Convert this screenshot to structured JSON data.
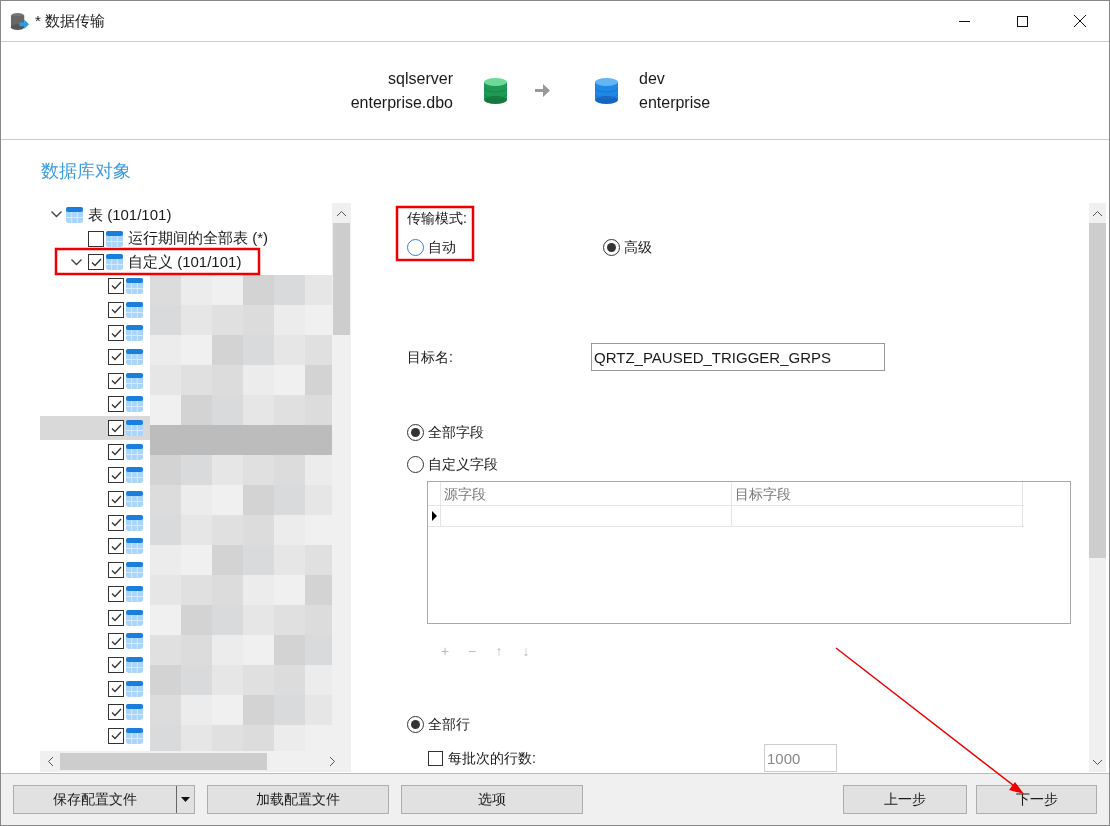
{
  "window": {
    "title": "* 数据传输"
  },
  "header": {
    "source": {
      "server": "sqlserver",
      "database": "enterprise.dbo"
    },
    "target": {
      "server": "dev",
      "database": "enterprise"
    }
  },
  "section_title": "数据库对象",
  "tree": [
    {
      "label": "表 (101/101)",
      "expanded": true,
      "children": [
        {
          "label": "运行期间的全部表 (*)",
          "checked": false
        },
        {
          "label": "自定义 (101/101)",
          "checked": true,
          "expanded": true,
          "children": [
            {
              "checked": true,
              "selected": false
            },
            {
              "checked": true,
              "selected": false
            },
            {
              "checked": true,
              "selected": false
            },
            {
              "checked": true,
              "selected": false
            },
            {
              "checked": true,
              "selected": false
            },
            {
              "checked": true,
              "selected": false
            },
            {
              "checked": true,
              "selected": true
            },
            {
              "checked": true,
              "selected": false
            },
            {
              "checked": true,
              "selected": false
            },
            {
              "checked": true,
              "selected": false
            },
            {
              "checked": true,
              "selected": false
            },
            {
              "checked": true,
              "selected": false
            },
            {
              "checked": true,
              "selected": false
            },
            {
              "checked": true,
              "selected": false
            },
            {
              "checked": true,
              "selected": false
            },
            {
              "checked": true,
              "selected": false
            },
            {
              "checked": true,
              "selected": false
            },
            {
              "checked": true,
              "selected": false
            },
            {
              "checked": true,
              "selected": false
            },
            {
              "checked": true,
              "selected": false
            }
          ]
        }
      ]
    }
  ],
  "transfer_mode": {
    "label": "传输模式:",
    "options": [
      {
        "label": "自动",
        "selected": false,
        "focused": true
      },
      {
        "label": "高级",
        "selected": true,
        "focused": false
      }
    ]
  },
  "target_name": {
    "label": "目标名:",
    "value": "QRTZ_PAUSED_TRIGGER_GRPS"
  },
  "field_mode": {
    "options": [
      {
        "label": "全部字段",
        "selected": true
      },
      {
        "label": "自定义字段",
        "selected": false
      }
    ]
  },
  "field_grid": {
    "columns": [
      "源字段",
      "目标字段"
    ]
  },
  "grid_toolbar": [
    {
      "label": "+",
      "disabled": true
    },
    {
      "label": "−",
      "disabled": true
    },
    {
      "label": "↑",
      "disabled": true
    },
    {
      "label": "↓",
      "disabled": true
    }
  ],
  "row_mode": {
    "options": [
      {
        "label": "全部行",
        "selected": true
      }
    ]
  },
  "batch": {
    "label": "每批次的行数:",
    "checked": false,
    "value": "1000",
    "disabled": true
  },
  "buttons": [
    {
      "label": "保存配置文件",
      "kind": "split"
    },
    {
      "label": "加载配置文件",
      "kind": "plain"
    },
    {
      "label": "选项",
      "kind": "plain"
    },
    {
      "label": "上一步",
      "kind": "nav"
    },
    {
      "label": "下一步",
      "kind": "nav"
    }
  ]
}
